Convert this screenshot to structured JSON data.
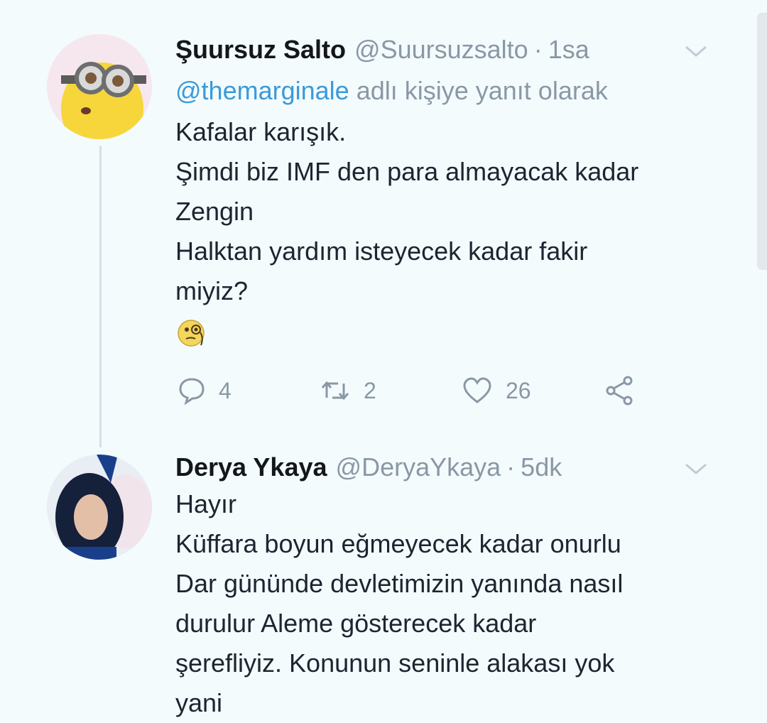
{
  "tweets": [
    {
      "name": "Şuursuz Salto",
      "handle": "@Suursuzsalto",
      "separator": "·",
      "time": "1sa",
      "reply_mention": "@themarginale",
      "reply_suffix": "adlı kişiye yanıt olarak",
      "lines": [
        "Kafalar karışık.",
        "Şimdi biz IMF den para almayacak kadar",
        "Zengin",
        "Halktan yardım isteyecek kadar fakir",
        "miyiz?"
      ],
      "emoji": "face-with-monocle-icon",
      "actions": {
        "reply_count": "4",
        "retweet_count": "2",
        "like_count": "26"
      }
    },
    {
      "name": "Derya Ykaya",
      "handle": "@DeryaYkaya",
      "separator": "·",
      "time": "5dk",
      "lines": [
        "Hayır",
        "Küffara boyun eğmeyecek kadar onurlu",
        "Dar gününde devletimizin yanında nasıl",
        "durulur Aleme gösterecek kadar",
        "şerefliyiz. Konunun seninle alakası yok",
        "yani"
      ]
    }
  ],
  "colors": {
    "background": "#f3fbfd",
    "text": "#1c2530",
    "muted": "#8a98a5",
    "link": "#3b9ad9"
  }
}
